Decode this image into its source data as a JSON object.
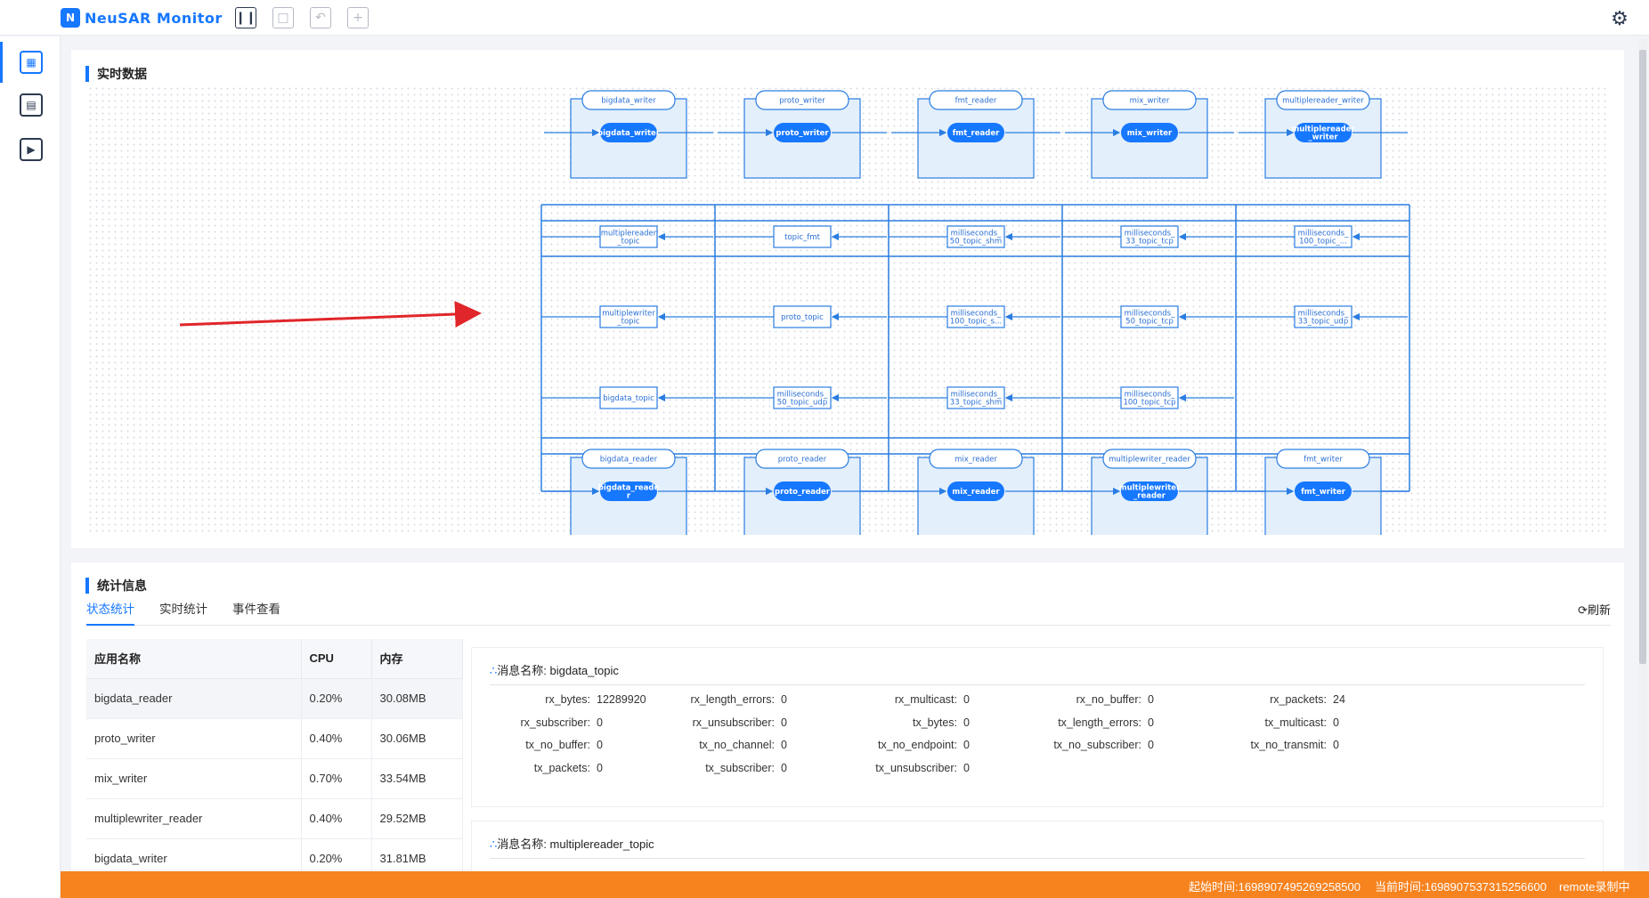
{
  "app": {
    "logo_mark": "N",
    "title": "NeuSAR Monitor"
  },
  "toolbar": {
    "pause_icon": "pause-icon",
    "tools": [
      "pause",
      "screen",
      "undo",
      "add"
    ],
    "settings_icon": "settings-gear-icon"
  },
  "sidebar": {
    "items": [
      "topology-icon",
      "chart-icon",
      "playback-icon"
    ]
  },
  "realtime": {
    "title": "实时数据"
  },
  "graph": {
    "writers": [
      {
        "outer": "bigdata_writer",
        "inner": "bigdata_writer"
      },
      {
        "outer": "proto_writer",
        "inner": "proto_writer"
      },
      {
        "outer": "fmt_reader",
        "inner": "fmt_reader"
      },
      {
        "outer": "mix_writer",
        "inner": "mix_writer"
      },
      {
        "outer": "multiplereader_writer",
        "inner": "multiplereader\n_writer"
      }
    ],
    "topics": [
      [
        "multiplereader\n_topic",
        "topic_fmt",
        "milliseconds_\n50_topic_shm",
        "milliseconds_\n33_topic_tcp",
        "milliseconds_\n100_topic_..."
      ],
      [
        "multiplewriter\n_topic",
        "proto_topic",
        "milliseconds_\n100_topic_s...",
        "milliseconds_\n50_topic_tcp",
        "milliseconds_\n33_topic_udp"
      ],
      [
        "bigdata_topic",
        "milliseconds_\n50_topic_udp",
        "milliseconds_\n33_topic_shm",
        "milliseconds_\n100_topic_tcp"
      ]
    ],
    "readers": [
      {
        "outer": "bigdata_reader",
        "inner": "bigdata_reade\nr"
      },
      {
        "outer": "proto_reader",
        "inner": "proto_reader"
      },
      {
        "outer": "mix_reader",
        "inner": "mix_reader"
      },
      {
        "outer": "multiplewriter_reader",
        "inner": "multiplewriter\n_reader"
      },
      {
        "outer": "fmt_writer",
        "inner": "fmt_writer"
      }
    ]
  },
  "stats": {
    "title": "统计信息",
    "tabs": [
      "状态统计",
      "实时统计",
      "事件查看"
    ],
    "refresh_label": "刷新",
    "table": {
      "headers": [
        "应用名称",
        "CPU",
        "内存"
      ],
      "rows": [
        [
          "bigdata_reader",
          "0.20%",
          "30.08MB"
        ],
        [
          "proto_writer",
          "0.40%",
          "30.06MB"
        ],
        [
          "mix_writer",
          "0.70%",
          "33.54MB"
        ],
        [
          "multiplewriter_reader",
          "0.40%",
          "29.52MB"
        ],
        [
          "bigdata_writer",
          "0.20%",
          "31.81MB"
        ]
      ]
    },
    "message1": {
      "prefix": "消息名称: ",
      "name": "bigdata_topic",
      "fields": [
        [
          "rx_bytes:",
          "12289920"
        ],
        [
          "rx_length_errors:",
          "0"
        ],
        [
          "rx_multicast:",
          "0"
        ],
        [
          "rx_no_buffer:",
          "0"
        ],
        [
          "rx_packets:",
          "24"
        ],
        [
          "rx_subscriber:",
          "0"
        ],
        [
          "rx_unsubscriber:",
          "0"
        ],
        [
          "tx_bytes:",
          "0"
        ],
        [
          "tx_length_errors:",
          "0"
        ],
        [
          "tx_multicast:",
          "0"
        ],
        [
          "tx_no_buffer:",
          "0"
        ],
        [
          "tx_no_channel:",
          "0"
        ],
        [
          "tx_no_endpoint:",
          "0"
        ],
        [
          "tx_no_subscriber:",
          "0"
        ],
        [
          "tx_no_transmit:",
          "0"
        ],
        [
          "tx_packets:",
          "0"
        ],
        [
          "tx_subscriber:",
          "0"
        ],
        [
          "tx_unsubscriber:",
          "0"
        ]
      ]
    },
    "message2": {
      "prefix": "消息名称: ",
      "name": "multiplereader_topic"
    }
  },
  "status": {
    "start": "起始时间:1698907495269258500",
    "current": "当前时间:1698907537315256600",
    "mode": "remote录制中"
  }
}
